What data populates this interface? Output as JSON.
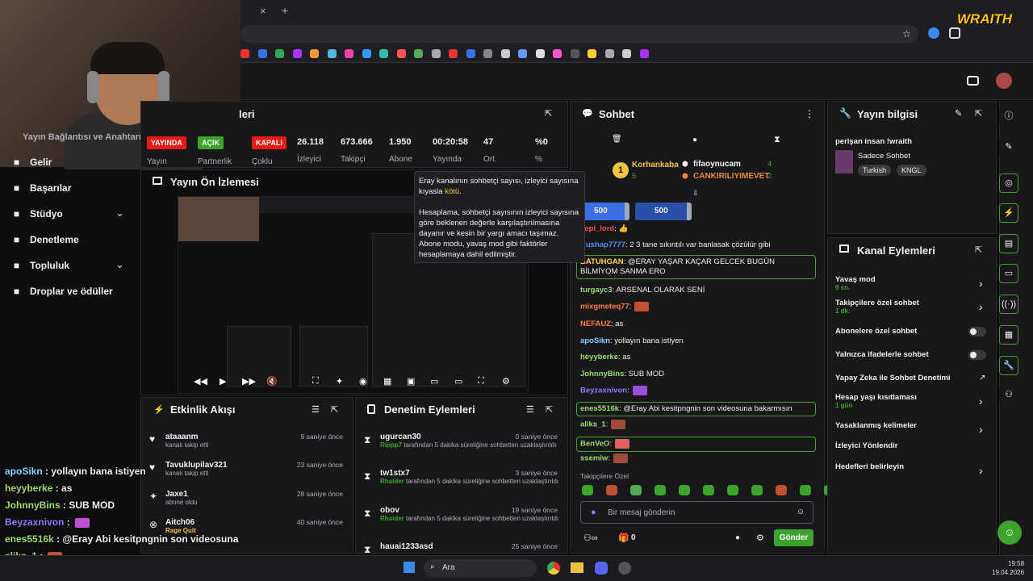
{
  "browser": {
    "tab_close": "×",
    "new_tab": "+"
  },
  "overlay_logo": "WRAITH",
  "sidebar": {
    "partial_label": "Yayın Bağlantısı ve Anahtarı",
    "items": [
      {
        "label": "Gelir",
        "icon": "revenue-icon"
      },
      {
        "label": "Başarılar",
        "icon": "trophy-icon"
      },
      {
        "label": "Stüdyo",
        "icon": "studio-icon"
      },
      {
        "label": "Denetleme",
        "icon": "wrench-icon"
      },
      {
        "label": "Topluluk",
        "icon": "community-icon"
      },
      {
        "label": "Droplar ve ödüller",
        "icon": "drops-icon"
      }
    ]
  },
  "stats_panel": {
    "title_partial": "leri",
    "badges": [
      {
        "label": "YAYINDA",
        "sub": "Yayın"
      },
      {
        "label": "AÇIK",
        "sub": "Partnerlik"
      },
      {
        "label": "KAPALI",
        "sub": "Çoklu"
      }
    ],
    "stats": [
      {
        "value": "26.118",
        "label": "İzleyici"
      },
      {
        "value": "673.666",
        "label": "Takipçi"
      },
      {
        "value": "1.950",
        "label": "Abone"
      },
      {
        "value": "00:20:58",
        "label": "Yayında"
      },
      {
        "value": "47",
        "label": "Ort."
      },
      {
        "value": "%0",
        "label": "%"
      }
    ]
  },
  "preview": {
    "title": "Yayın Ön İzlemesi"
  },
  "tooltip": {
    "line1_a": "Eray kanalının sohbetçi sayısı, izleyici sayısına kıyasla ",
    "line1_b": "kötü",
    "line1_c": ".",
    "line2": "Hesaplama, sohbetçi sayısının izleyici sayısına göre beklenen değerle karşılaştırılmasına dayanır ve kesin bir yargı amacı taşımaz. Abone modu, yavaş mod gibi faktörler hesaplamaya dahil edilmiştir."
  },
  "activity": {
    "title": "Etkinlik Akışı",
    "items": [
      {
        "name": "ataaanm",
        "sub": "kanalı takip etti",
        "time": "9 saniye önce"
      },
      {
        "name": "Tavuklupilav321",
        "sub": "kanalı takip etti",
        "time": "23 saniye önce"
      },
      {
        "name": "Jaxe1",
        "sub": "abone oldu",
        "time": "28 saniye önce"
      },
      {
        "name": "Aitch06",
        "sub": "Rage Quit",
        "time": "40 saniye önce"
      }
    ]
  },
  "mod_actions": {
    "title": "Denetim Eylemleri",
    "items": [
      {
        "name": "ugurcan30",
        "by": "Rippp7",
        "rest": " tarafından 5 dakika süreliğine sohbetten uzaklaştırıldı",
        "time": "0 saniye önce"
      },
      {
        "name": "tw1stx7",
        "by": "Rhaider",
        "rest": " tarafından 5 dakika süreliğine sohbetten uzaklaştırıldı",
        "time": "3 saniye önce"
      },
      {
        "name": "obov",
        "by": "Rhaider",
        "rest": " tarafından 5 dakika süreliğine sohbetten uzaklaştırıldı",
        "time": "19 saniye önce"
      },
      {
        "name": "hauai1233asd",
        "time": "25 saniye önce"
      }
    ]
  },
  "chat": {
    "title": "Sohbet",
    "top_gifter": {
      "name": "Korhankaba",
      "count": "5"
    },
    "gifters": [
      {
        "name": "fifaoynucam",
        "count": "4"
      },
      {
        "name": "CANKIRILIYIMEVET",
        "count": "2"
      }
    ],
    "hype": [
      "500",
      "500"
    ],
    "messages": [
      {
        "user": "cepi_lord",
        "color": "#ff4f4f",
        "text": ": 👍",
        "hl": false
      },
      {
        "user": "Rushap7777",
        "color": "#4f8fff",
        "text": ": 2 3 tane sıkıntılı var banlasak çözülür gibi",
        "hl": false
      },
      {
        "user": "BATUHGAN",
        "color": "#ffd54f",
        "text": ": @ERAY YAŞAR KAÇAR GELCEK BUGÜN BİLMİYOM SANMA ERO",
        "hl": true
      },
      {
        "user": "turgayc3",
        "color": "#9bdc6b",
        "text": ": ARSENAL OLARAK SENİ",
        "hl": false
      },
      {
        "user": "mixgmeteq77",
        "color": "#ff7f3f",
        "text": ":",
        "hl": false
      },
      {
        "user": "NEFAUZ",
        "color": "#ff7f3f",
        "text": ": as",
        "hl": false
      },
      {
        "user": "apoSikn",
        "color": "#7fd3ff",
        "text": ": yollayın bana istiyen",
        "hl": false
      },
      {
        "user": "heyyberke",
        "color": "#9bdc6b",
        "text": ": as",
        "hl": false
      },
      {
        "user": "JohnnyBins",
        "color": "#9bdc6b",
        "text": ": SUB MOD",
        "hl": false
      },
      {
        "user": "Beyzaxnivon",
        "color": "#8a7bff",
        "text": ":",
        "hl": false
      },
      {
        "user": "enes5516k",
        "color": "#9bdc6b",
        "text": ": @Eray Abi kesitpngnin son videosuna bakarmısın",
        "hl": true
      },
      {
        "user": "aliks_1",
        "color": "#9bdc6b",
        "text": ":",
        "hl": false
      },
      {
        "user": "BenVeO",
        "color": "#9bdc6b",
        "text": ":",
        "hl": true
      },
      {
        "user": "ssemiw",
        "color": "#9bdc6b",
        "text": ":",
        "hl": false
      }
    ],
    "follower_only": "Takipçilere Özel",
    "input_placeholder": "Bir mesaj gönderin",
    "points": "0",
    "send": "Gönder"
  },
  "stream_info": {
    "title": "Yayın bilgisi",
    "stream_title": "perişan insan !wraith",
    "category": "Sadece Sohbet",
    "tags": [
      "Turkish",
      "KNGL"
    ]
  },
  "channel_actions": {
    "title": "Kanal Eylemleri",
    "items": [
      {
        "label": "Yavaş mod",
        "sub": "9 sn.",
        "type": "chevron"
      },
      {
        "label": "Takipçilere özel sohbet",
        "sub": "1 dk.",
        "type": "chevron"
      },
      {
        "label": "Abonelere özel sohbet",
        "sub": "",
        "type": "toggle"
      },
      {
        "label": "Yalnızca ifadelerle sohbet",
        "sub": "",
        "type": "toggle"
      },
      {
        "label": "Yapay Zeka ile Sohbet Denetimi",
        "sub": "",
        "type": "external"
      },
      {
        "label": "Hesap yaşı kısıtlaması",
        "sub": "1 gün",
        "type": "chevron"
      },
      {
        "label": "Yasaklanmış kelimeler",
        "sub": "",
        "type": "chevron"
      },
      {
        "label": "İzleyici Yönlendir",
        "sub": "",
        "type": "none"
      },
      {
        "label": "Hedefleri belirleyin",
        "sub": "",
        "type": "chevron"
      }
    ]
  },
  "overlay_chat": [
    {
      "user": "apoSikn",
      "color": "#7fd3ff",
      "text": " : yollayın bana istiyen"
    },
    {
      "user": "heyyberke",
      "color": "#9bdc6b",
      "text": " : as"
    },
    {
      "user": "JohnnyBins",
      "color": "#9bdc6b",
      "text": " : SUB MOD"
    },
    {
      "user": "Beyzaxnivon",
      "color": "#8a7bff",
      "text": " :"
    },
    {
      "user": "enes5516k",
      "color": "#9bdc6b",
      "text": " : @Eray Abi kesitpngnin son videosuna"
    },
    {
      "user": "aliks_1",
      "color": "#9bdc6b",
      "text": " :"
    },
    {
      "user": "BenVeO",
      "color": "#9bdc6b",
      "text": " :"
    }
  ],
  "taskbar": {
    "search": "Ara",
    "time": "19:58",
    "date": "19.04.2026"
  }
}
